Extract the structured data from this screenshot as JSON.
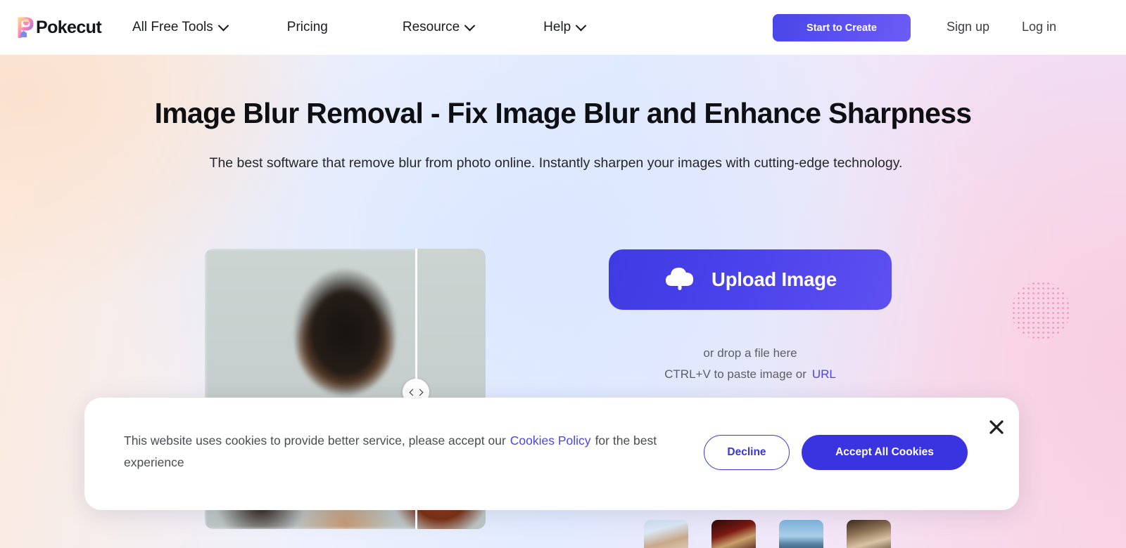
{
  "header": {
    "logo_text": "Pokecut",
    "logo_icon": "pokecut-p-mascot-logo",
    "nav": [
      {
        "label": "All Free Tools",
        "has_dropdown": true,
        "icon": "chevron-down-icon"
      },
      {
        "label": "Pricing",
        "has_dropdown": false,
        "icon": ""
      },
      {
        "label": "Resource",
        "has_dropdown": true,
        "icon": "chevron-down-icon"
      },
      {
        "label": "Help",
        "has_dropdown": true,
        "icon": "chevron-down-icon"
      }
    ],
    "cta_label": "Start to Create",
    "signup_label": "Sign up",
    "login_label": "Log in"
  },
  "hero": {
    "title": "Image Blur Removal - Fix Image Blur and Enhance Sharpness",
    "subtitle": "The best software that remove blur from photo online. Instantly sharpen your images with cutting-edge technology."
  },
  "compare": {
    "name": "before-after-comparison-slider",
    "handle_icon_left": "chevron-left-icon",
    "handle_icon_right": "chevron-right-icon",
    "divider_position_pct": 75
  },
  "upload": {
    "button_label": "Upload Image",
    "button_icon": "cloud-upload-icon",
    "drop_hint": "or drop a file here",
    "paste_hint": "CTRL+V to paste image or",
    "url_label": "URL",
    "samples": [
      {
        "name": "sample-thumbnail-1"
      },
      {
        "name": "sample-thumbnail-2"
      },
      {
        "name": "sample-thumbnail-3"
      },
      {
        "name": "sample-thumbnail-4"
      }
    ]
  },
  "cookie_banner": {
    "text_before": "This website uses cookies to provide better service, please accept our",
    "policy_link": "Cookies Policy",
    "text_after": "for the best experience",
    "decline_label": "Decline",
    "accept_label": "Accept All Cookies",
    "close_icon": "close-icon"
  },
  "colors": {
    "brand_primary": "#3a34e0",
    "brand_gradient_start": "#3f3ae3",
    "brand_gradient_end": "#5e50f2",
    "link": "#4a46e8",
    "text_dark": "#0e0f12",
    "text_muted": "#5c5e66",
    "decor_dots": "#f06aa4"
  }
}
